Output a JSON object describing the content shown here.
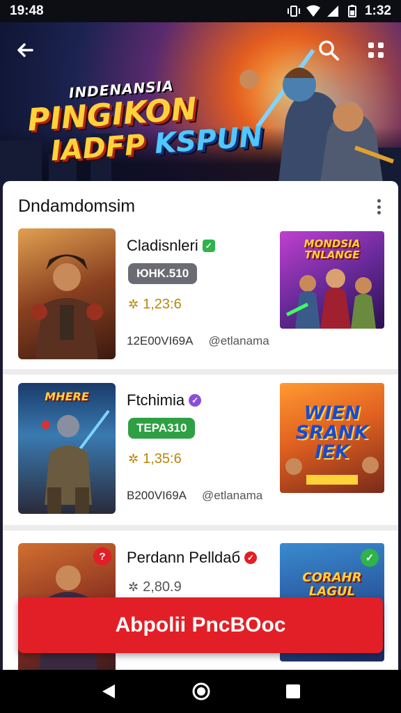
{
  "status_bar": {
    "time": "19:48",
    "clock": "1:32"
  },
  "hero": {
    "title_small": "INDENANSIA",
    "title_line1": "PINGIKON",
    "title_line2a": "IADFP",
    "title_line2b": "KSPUN",
    "back_icon": "back-arrow-icon",
    "search_icon": "search-icon",
    "menu_icon": "grid-icon"
  },
  "section": {
    "title": "Dndamdomsim"
  },
  "items": [
    {
      "title": "Cladisnleri",
      "tag": "ЮHK.510",
      "tag_color": "#6b6b73",
      "verify_color": "#2fb34a",
      "rating": "1,23:6",
      "code": "12E00VI69A",
      "handle": "@etlanama",
      "thumb_label": "MONDSIA TNLANGE"
    },
    {
      "title": "Ftchimia",
      "tag": "TEPA310",
      "tag_color": "#2ea043",
      "verify_color": "#8a4fd8",
      "rating": "1,35:6",
      "code": "B200VI69A",
      "handle": "@etlanama",
      "thumb_label_small": "MHERE",
      "thumb_label": "WIEN SRANK IEK"
    },
    {
      "title": "Perdann Pelldaб",
      "verify_color": "#e21f26",
      "rating": "2,80.9",
      "thumb_label": "CORAHR LAGUL"
    }
  ],
  "cta": {
    "label": "Abpolii PncBOoc"
  },
  "colors": {
    "accent": "#e21f26",
    "title_gold": "#ffd23a"
  }
}
